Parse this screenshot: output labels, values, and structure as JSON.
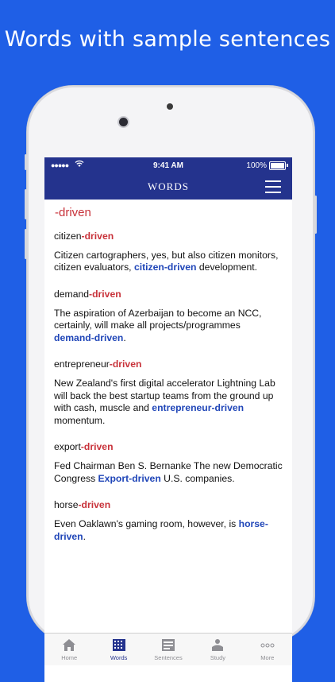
{
  "promo": {
    "title": "Words with sample sentences"
  },
  "status_bar": {
    "signal": "●●●●●",
    "time": "9:41 AM",
    "battery": "100%"
  },
  "nav": {
    "title": "WORDS"
  },
  "heading": "-driven",
  "entries": [
    {
      "word_prefix": "citizen",
      "word_suffix": "-driven",
      "sentence_before": "Citizen cartographers, yes, but also citizen monitors, citizen evaluators, ",
      "sentence_highlight": "citizen-driven",
      "sentence_after": " development."
    },
    {
      "word_prefix": "demand",
      "word_suffix": "-driven",
      "sentence_before": "The aspiration of Azerbaijan to become an NCC, certainly, will make all projects/programmes ",
      "sentence_highlight": "demand-driven",
      "sentence_after": "."
    },
    {
      "word_prefix": "entrepreneur",
      "word_suffix": "-driven",
      "sentence_before": "New Zealand's first digital accelerator Lightning Lab will back the best startup teams from the ground up with cash, muscle and ",
      "sentence_highlight": "entrepreneur-driven",
      "sentence_after": " momentum."
    },
    {
      "word_prefix": "export",
      "word_suffix": "-driven",
      "sentence_before": "Fed Chairman Ben S. Bernanke The new Democratic Congress ",
      "sentence_highlight": "Export-driven",
      "sentence_after": " U.S. companies."
    },
    {
      "word_prefix": "horse",
      "word_suffix": "-driven",
      "sentence_before": "Even Oaklawn's gaming room, however, is ",
      "sentence_highlight": "horse-driven",
      "sentence_after": "."
    }
  ],
  "tabs": [
    {
      "label": "Home",
      "icon": "home-icon",
      "active": false
    },
    {
      "label": "Words",
      "icon": "words-icon",
      "active": true
    },
    {
      "label": "Sentences",
      "icon": "sentences-icon",
      "active": false
    },
    {
      "label": "Study",
      "icon": "study-icon",
      "active": false
    },
    {
      "label": "More",
      "icon": "more-icon",
      "active": false
    }
  ],
  "colors": {
    "background": "#1f5fe6",
    "nav": "#24338d",
    "suffix_red": "#c8323a",
    "highlight_blue": "#2046b8"
  }
}
